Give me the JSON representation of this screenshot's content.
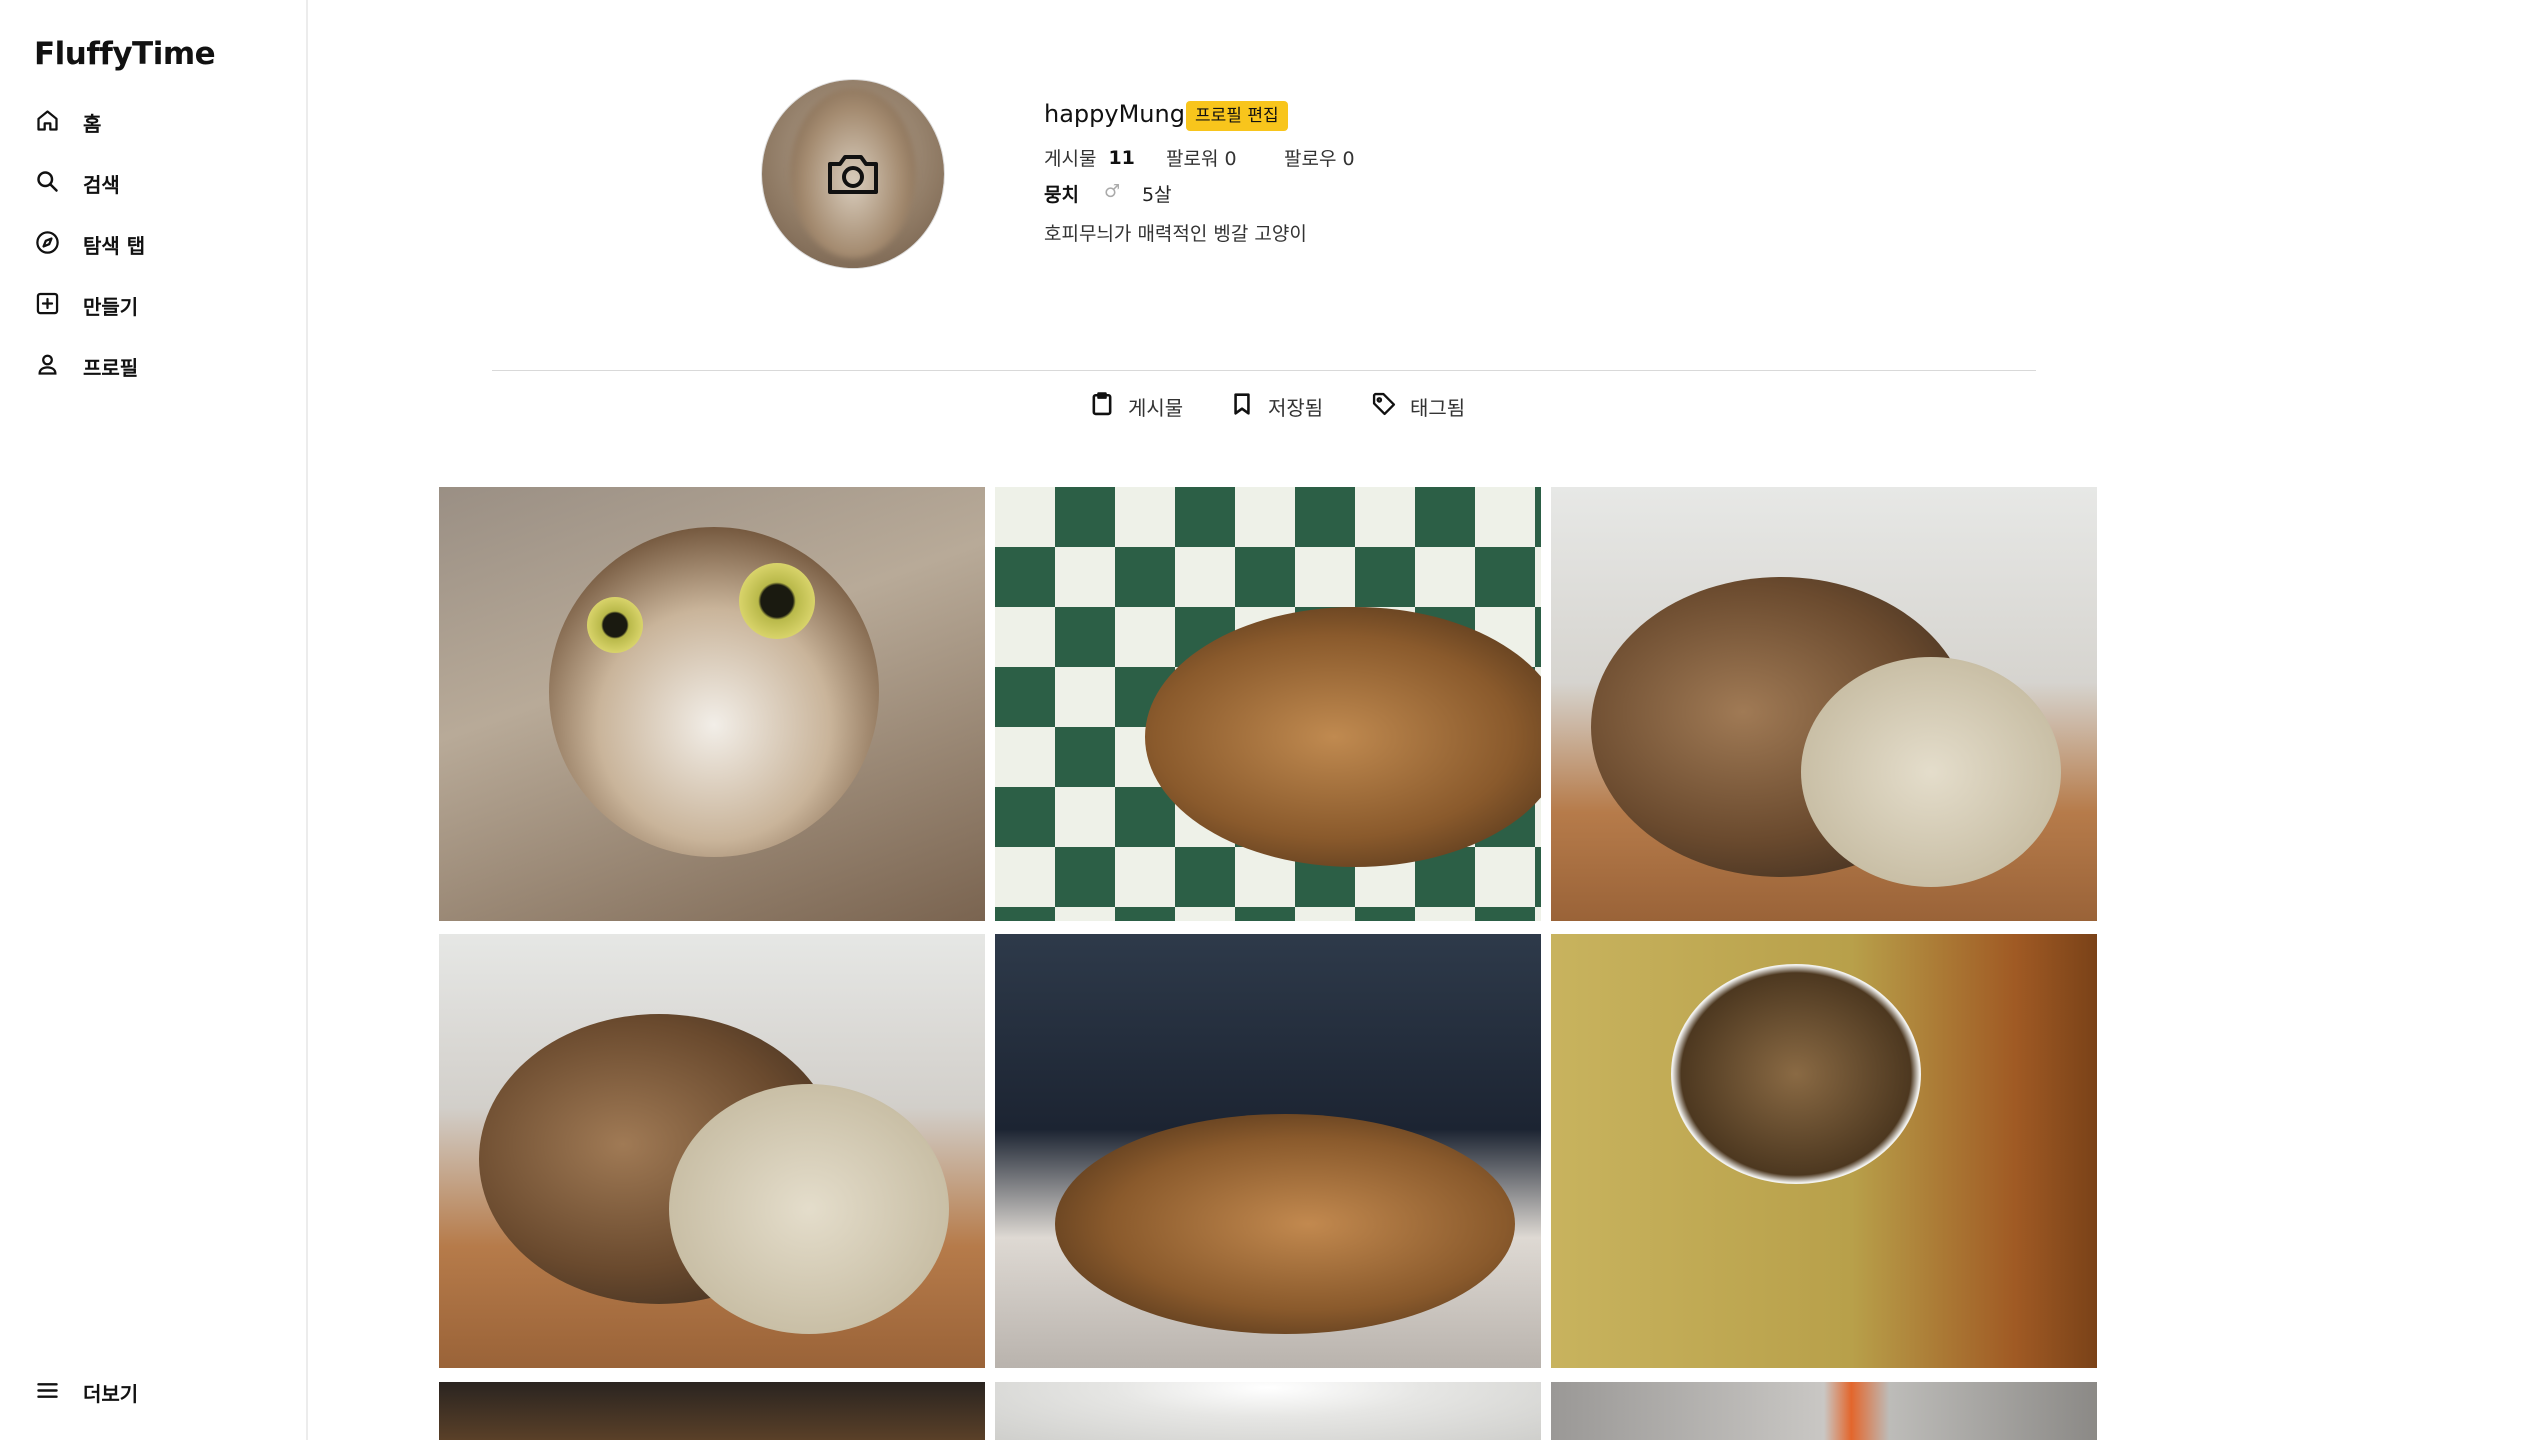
{
  "app": {
    "title": "FluffyTime"
  },
  "sidebar": {
    "items": [
      {
        "label": "홈",
        "icon": "home-icon"
      },
      {
        "label": "검색",
        "icon": "search-icon"
      },
      {
        "label": "탐색 탭",
        "icon": "compass-icon"
      },
      {
        "label": "만들기",
        "icon": "plus-square-icon"
      },
      {
        "label": "프로필",
        "icon": "person-icon"
      }
    ],
    "more": {
      "label": "더보기",
      "icon": "menu-icon"
    }
  },
  "profile": {
    "username": "happyMung",
    "edit_label": "프로필 편집",
    "posts_label": "게시물",
    "posts_count": "11",
    "followers_label": "팔로워 0",
    "following_label": "팔로우 0",
    "pet_name": "뭉치",
    "gender_symbol": "♂",
    "age": "5살",
    "bio": "호피무늬가 매력적인 벵갈 고양이"
  },
  "tabs": [
    {
      "label": "게시물",
      "icon": "clipboard-icon"
    },
    {
      "label": "저장됨",
      "icon": "bookmark-icon"
    },
    {
      "label": "태그됨",
      "icon": "tag-icon"
    }
  ],
  "colors": {
    "accent": "#f8c51c",
    "divider": "#d9d9d9"
  }
}
